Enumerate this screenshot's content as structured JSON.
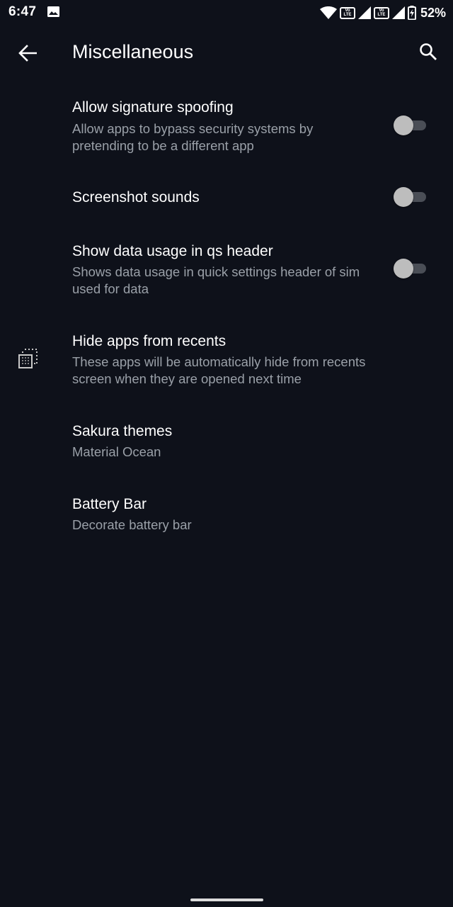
{
  "status_bar": {
    "time": "6:47",
    "volte_top": "Vo",
    "volte_bottom": "LTE",
    "battery_percent": "52%",
    "icons": [
      "gallery-icon",
      "wifi-icon",
      "volte-icon",
      "signal-icon",
      "volte-icon",
      "signal-icon",
      "battery-charging-icon"
    ]
  },
  "app_bar": {
    "title": "Miscellaneous",
    "back_icon": "arrow-back-icon",
    "search_icon": "search-icon"
  },
  "preferences": [
    {
      "title": "Allow signature spoofing",
      "summary": "Allow apps to bypass security systems by pretending to be a different app",
      "switch_on": false
    },
    {
      "title": "Screenshot sounds",
      "switch_on": false
    },
    {
      "title": "Show data usage in qs header",
      "summary": "Shows data usage in quick settings header of sim used for data",
      "switch_on": false
    },
    {
      "title": "Hide apps from recents",
      "summary": "These apps will be automatically hide from recents screen when they are opened next time",
      "icon": "recents-stack-icon"
    },
    {
      "title": "Sakura themes",
      "summary": "Material Ocean"
    },
    {
      "title": "Battery Bar",
      "summary": "Decorate battery bar"
    }
  ],
  "colors": {
    "background": "#0e111a",
    "title_text": "#ffffff",
    "summary_text": "#9aa0a8",
    "switch_thumb_off": "#bdbdbd",
    "switch_track_off": "#4a4e56"
  }
}
